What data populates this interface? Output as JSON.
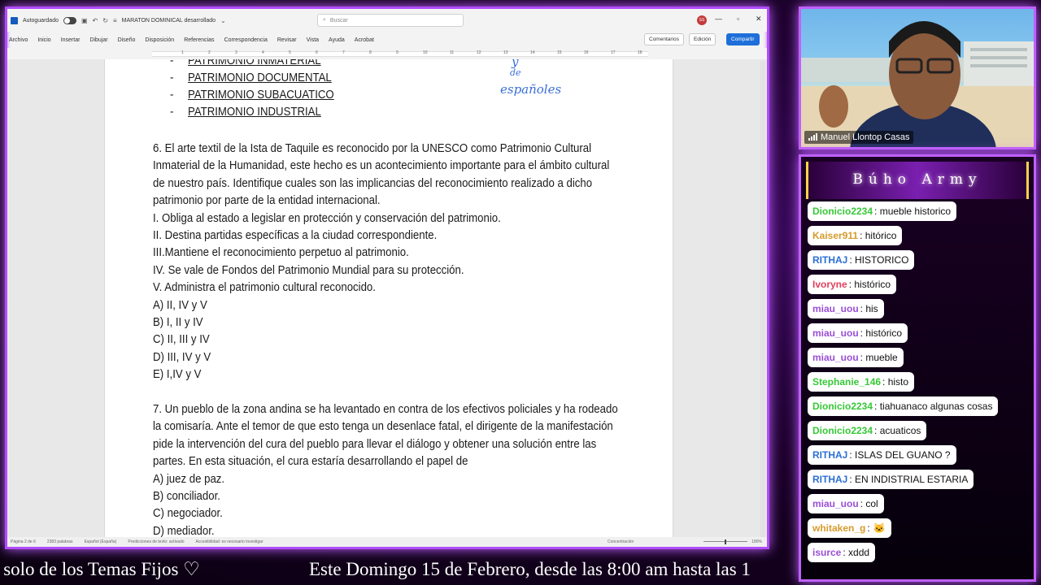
{
  "word": {
    "autosave_label": "Autoguardado",
    "doc_title": "MARATON DOMINICAL desarrollado",
    "search_placeholder": "Buscar",
    "user_initials": "SS",
    "menu": [
      "Archivo",
      "Inicio",
      "Insertar",
      "Dibujar",
      "Diseño",
      "Disposición",
      "Referencias",
      "Correspondencia",
      "Revisar",
      "Vista",
      "Ayuda",
      "Acrobat"
    ],
    "comments_label": "Comentarios",
    "editing_label": "Edición",
    "share_label": "Compartir",
    "ruler_numbers": [
      "1",
      "2",
      "3",
      "4",
      "5",
      "6",
      "7",
      "8",
      "9",
      "10",
      "11",
      "12",
      "13",
      "14",
      "15",
      "16",
      "17",
      "18"
    ],
    "status": {
      "page": "Página 2 de 6",
      "words": "2383 palabras",
      "language": "Español (España)",
      "predictions": "Predicciones de texto: activado",
      "accessibility": "Accesibilidad: es necesario investigar",
      "focus": "Concentración",
      "zoom": "180%"
    }
  },
  "document": {
    "bullets": [
      "PATRIMONIO INMATERIAL",
      "PATRIMONIO DOCUMENTAL",
      "PATRIMONIO SUBACUATICO",
      "PATRIMONIO INDUSTRIAL"
    ],
    "ink_annotation_1": "y",
    "ink_annotation_2": "de",
    "ink_annotation_3": "españoles",
    "q6_lines": [
      "6. El arte textil de la Ista de Taquile es reconocido por la UNESCO como Patrimonio Cultural",
      "Inmaterial de la Humanidad, este hecho es un acontecimiento importante para el ámbito cultural",
      "de nuestro país. Identifique cuales son las implicancias del reconocimiento realizado a dicho",
      "patrimonio por parte de la entidad internacional.",
      "I.  Obliga al estado a legislar en protección y conservación del patrimonio.",
      "II. Destina partidas específicas a la ciudad correspondiente.",
      "III.Mantiene el reconocimiento perpetuo al patrimonio.",
      "IV.  Se vale de Fondos del Patrimonio Mundial para su protección.",
      "V. Administra el patrimonio cultural reconocido.",
      "A) II, IV y V",
      "B) I, II y IV",
      "C) II, III y IV",
      "D) III, IV y V",
      "E) I,IV y V"
    ],
    "q7_lines": [
      "7.  Un pueblo de la zona andina se ha levantado en contra de los efectivos policiales y ha rodeado",
      "la comisaría. Ante el temor de que esto tenga un desenlace fatal, el dirigente de la manifestación",
      "pide la intervención del cura del pueblo para llevar el diálogo y obtener una solución entre las",
      "partes. En esta situación, el cura estaría desarrollando el papel de",
      "A) juez de paz.",
      "B) conciliador.",
      "C) negociador.",
      "D) mediador."
    ]
  },
  "cam": {
    "name": "Manuel Llontop Casas"
  },
  "chat": {
    "title": "Búho Army",
    "messages": [
      {
        "nick": "Dionicio2234",
        "text": ": mueble historico",
        "color": "#37c837"
      },
      {
        "nick": "Kaiser911",
        "text": ": hitórico",
        "color": "#d69b2b"
      },
      {
        "nick": "RITHAJ",
        "text": ": HISTORICO",
        "color": "#2b6fd6"
      },
      {
        "nick": "Ivoryne",
        "text": ": histórico",
        "color": "#e0405f"
      },
      {
        "nick": "miau_uou",
        "text": ": his",
        "color": "#9a4fd6"
      },
      {
        "nick": "miau_uou",
        "text": ": histórico",
        "color": "#9a4fd6"
      },
      {
        "nick": "miau_uou",
        "text": ": mueble",
        "color": "#9a4fd6"
      },
      {
        "nick": "Stephanie_146",
        "text": ": histo",
        "color": "#37c837"
      },
      {
        "nick": "Dionicio2234",
        "text": ": tiahuanaco algunas cosas",
        "color": "#37c837"
      },
      {
        "nick": "Dionicio2234",
        "text": ": acuaticos",
        "color": "#37c837"
      },
      {
        "nick": "RITHAJ",
        "text": ": ISLAS DEL GUANO ?",
        "color": "#2b6fd6"
      },
      {
        "nick": "RITHAJ",
        "text": ": EN INDISTRIAL ESTARIA",
        "color": "#2b6fd6"
      },
      {
        "nick": "miau_uou",
        "text": ": col",
        "color": "#9a4fd6"
      },
      {
        "nick": "whitaken_g",
        "text": ":",
        "color": "#d69b2b"
      },
      {
        "nick": "isurce",
        "text": ": xddd",
        "color": "#9a4fd6"
      }
    ]
  },
  "ticker": {
    "part1": "os solo de los Temas Fijos ♡",
    "part2": "Este Domingo 15 de Febrero, desde las 8:00 am hasta las 1"
  }
}
